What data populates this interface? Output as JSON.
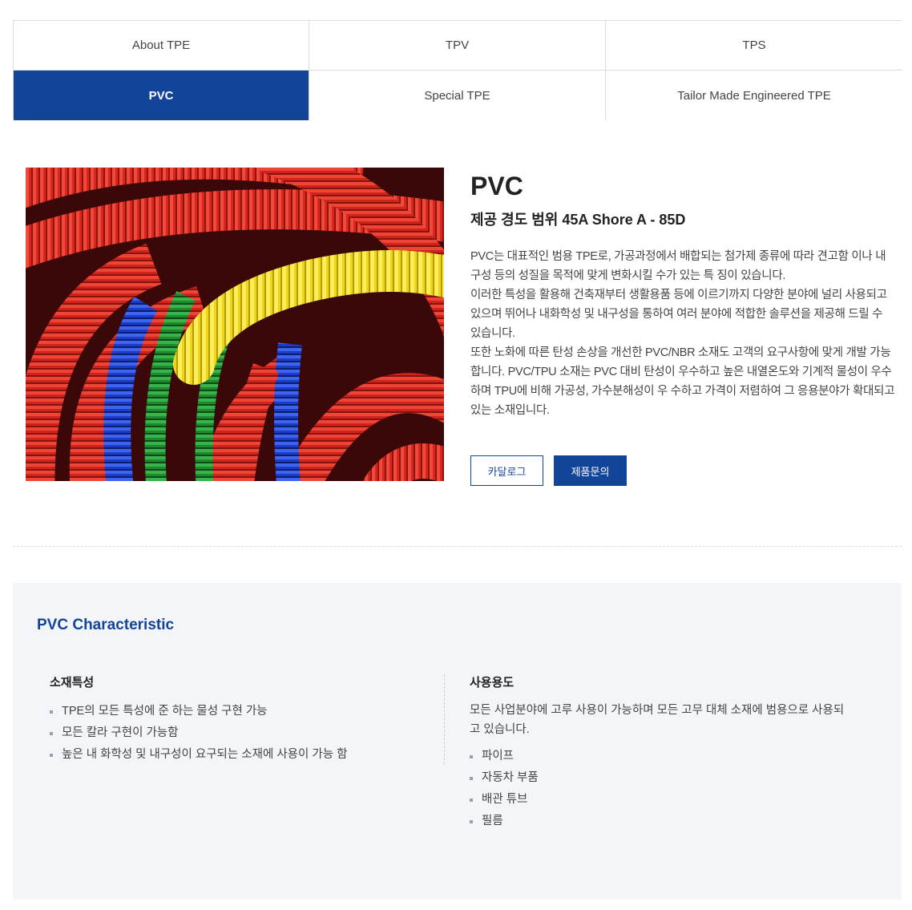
{
  "tabs": [
    {
      "label": "About TPE",
      "active": false
    },
    {
      "label": "TPV",
      "active": false
    },
    {
      "label": "TPS",
      "active": false
    },
    {
      "label": "PVC",
      "active": true
    },
    {
      "label": "Special TPE",
      "active": false
    },
    {
      "label": "Tailor Made Engineered TPE",
      "active": false
    }
  ],
  "product": {
    "title": "PVC",
    "subtitle": "제공 경도 범위 45A Shore A - 85D",
    "description": [
      "PVC는 대표적인 범용 TPE로, 가공과정에서 배합되는 첨가제 종류에 따라 견고함 이나 내구성 등의 성질을 목적에 맞게 변화시킬 수가 있는 특 징이 있습니다.",
      "이러한 특성을 활용해 건축재부터 생활용품 등에 이르기까지 다양한 분야에 널리 사용되고 있으며 뛰어나 내화학성 및 내구성을 통하여 여러 분야에 적합한 솔루션을 제공해 드릴 수 있습니다.",
      "또한 노화에 따른 탄성 손상을 개선한 PVC/NBR 소재도 고객의 요구사항에 맞게 개발 가능합니다. PVC/TPU 소재는 PVC 대비 탄성이 우수하고 높은 내열온도와 기계적 물성이 우수하며 TPU에 비해 가공성, 가수분해성이 우 수하고 가격이 저렴하여 그 응용분야가 확대되고 있는 소재입니다."
    ],
    "buttons": {
      "catalog": "카달로그",
      "inquiry": "제품문의"
    }
  },
  "characteristic": {
    "title": "PVC Characteristic",
    "material": {
      "heading": "소재특성",
      "items": [
        "TPE의 모든 특성에 준 하는 물성 구현 가능",
        "모든 칼라 구현이 가능함",
        "높은 내 화학성 및 내구성이 요구되는 소재에 사용이 가능 함"
      ]
    },
    "usage": {
      "heading": "사용용도",
      "text": "모든 사업분야에 고루 사용이 가능하며 모든 고무 대체 소재에 범용으로 사용되고 있습니다.",
      "items": [
        "파이프",
        "자동차 부품",
        "배관 튜브",
        "필름"
      ]
    }
  },
  "colors": {
    "brand": "#12449a",
    "panel_bg": "#f4f5f9"
  }
}
